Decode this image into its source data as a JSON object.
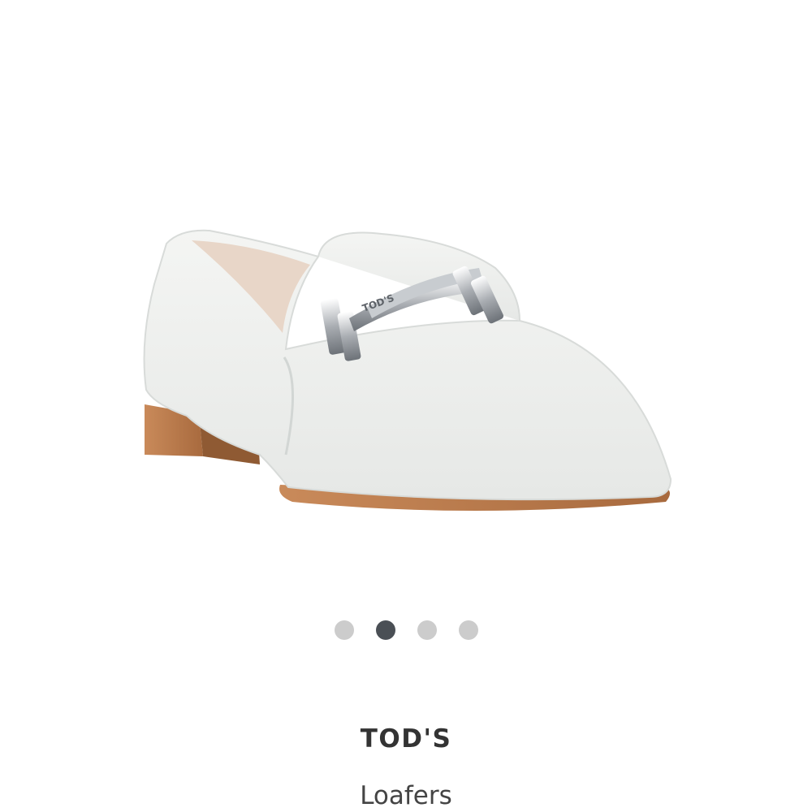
{
  "product": {
    "brand": "TOD'S",
    "category": "Loafers",
    "image_icon": "white-leather-loafer-with-metal-bit",
    "logo_engraving": "TOD'S"
  },
  "carousel": {
    "total_slides": 4,
    "active_slide": 2,
    "active_color": "#4a4f55",
    "inactive_color": "#cccccc"
  },
  "colors": {
    "background": "#ffffff",
    "brand_text": "#333333",
    "category_text": "#444444"
  }
}
